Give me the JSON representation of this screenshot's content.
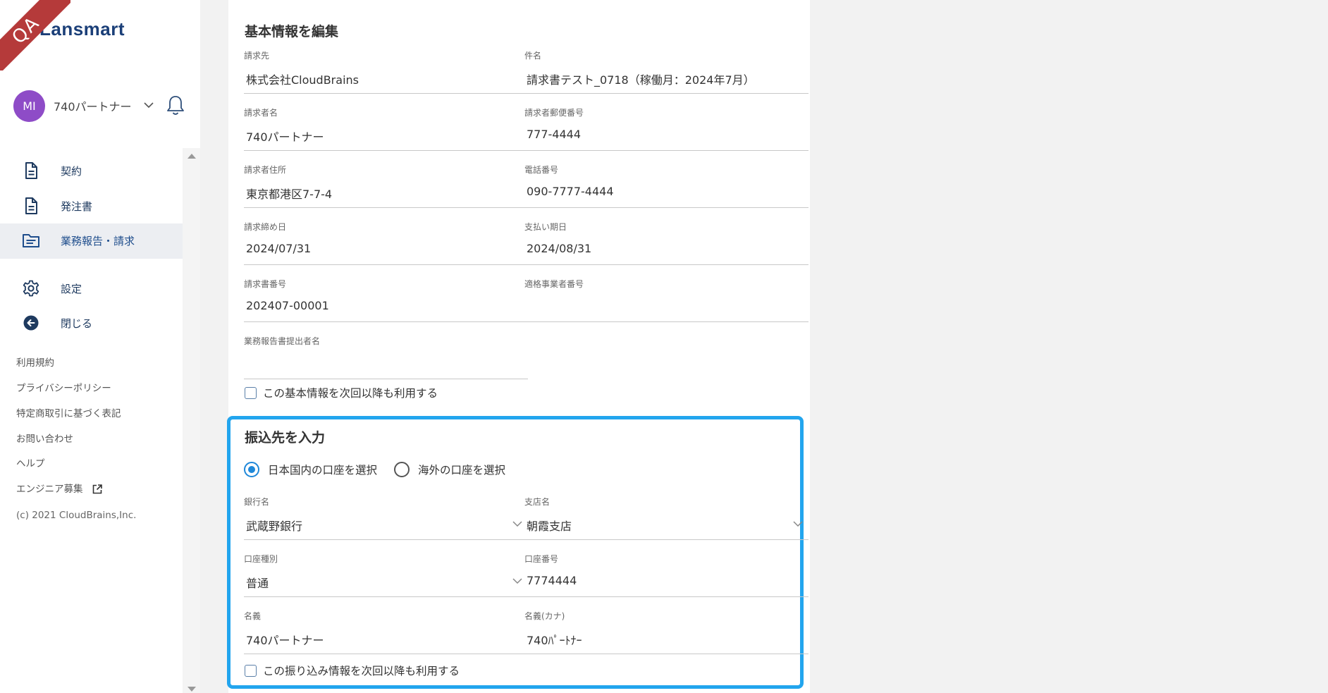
{
  "env_badge": "QA",
  "brand": {
    "name": "Lansmart"
  },
  "user": {
    "initials": "MI",
    "name": "740パートナー"
  },
  "nav": {
    "items": [
      {
        "label": "契約",
        "icon": "document-icon"
      },
      {
        "label": "発注書",
        "icon": "document-icon"
      },
      {
        "label": "業務報告・請求",
        "icon": "folder-icon",
        "active": true
      },
      {
        "label": "設定",
        "icon": "gear-icon"
      },
      {
        "label": "閉じる",
        "icon": "back-arrow-icon"
      }
    ],
    "footer_links": [
      "利用規約",
      "プライバシーポリシー",
      "特定商取引に基づく表記",
      "お問い合わせ",
      "ヘルプ",
      "エンジニア募集"
    ],
    "copyright": "(c) 2021 CloudBrains,Inc."
  },
  "basic_info": {
    "title": "基本情報を編集",
    "fields": {
      "billing_to": {
        "label": "請求先",
        "value": "株式会社CloudBrains"
      },
      "subject": {
        "label": "件名",
        "value": "請求書テスト_0718（稼働月：2024年7月）"
      },
      "requester_name": {
        "label": "請求者名",
        "value": "740パートナー"
      },
      "postal_code": {
        "label": "請求者郵便番号",
        "value": "777-4444"
      },
      "address": {
        "label": "請求者住所",
        "value": "東京都港区7-7-4"
      },
      "phone": {
        "label": "電話番号",
        "value": "090-7777-4444"
      },
      "closing_date": {
        "label": "請求締め日",
        "value": "2024/07/31"
      },
      "payment_due": {
        "label": "支払い期日",
        "value": "2024/08/31"
      },
      "invoice_number": {
        "label": "請求書番号",
        "value": "202407-00001"
      },
      "qualified_number": {
        "label": "適格事業者番号",
        "value": ""
      },
      "report_submitter": {
        "label": "業務報告書提出者名",
        "value": ""
      }
    },
    "reuse_label": "この基本情報を次回以降も利用する"
  },
  "transfer": {
    "title": "振込先を入力",
    "radio_domestic": "日本国内の口座を選択",
    "radio_overseas": "海外の口座を選択",
    "fields": {
      "bank": {
        "label": "銀行名",
        "value": "武蔵野銀行"
      },
      "branch": {
        "label": "支店名",
        "value": "朝霞支店"
      },
      "account_type": {
        "label": "口座種別",
        "value": "普通"
      },
      "account_number": {
        "label": "口座番号",
        "value": "7774444"
      },
      "holder": {
        "label": "名義",
        "value": "740パートナー"
      },
      "holder_kana": {
        "label": "名義(カナ)",
        "value": "740ﾊﾟｰﾄﾅｰ"
      }
    },
    "reuse_label": "この振り込み情報を次回以降も利用する"
  },
  "colors": {
    "accent": "#22a5ee",
    "nav_text": "#1e3a5f",
    "avatar": "#8e4cc7",
    "ribbon": "#b53a3a"
  }
}
